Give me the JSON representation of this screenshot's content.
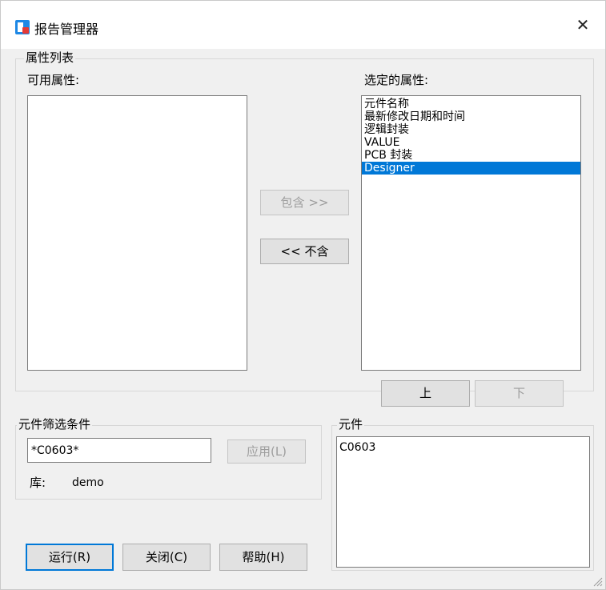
{
  "window": {
    "title": "报告管理器",
    "close_glyph": "✕"
  },
  "property_group": {
    "title": "属性列表",
    "available_label": "可用属性:",
    "selected_label": "选定的属性:",
    "available_items": [],
    "selected_items": [
      "元件名称",
      "最新修改日期和时间",
      "逻辑封装",
      "VALUE",
      "PCB 封装",
      "Designer"
    ],
    "selected_index": 5,
    "include_button": "包含 >>",
    "exclude_button": "<< 不含",
    "up_button": "上",
    "down_button": "下"
  },
  "filter_group": {
    "title": "元件筛选条件",
    "filter_value": "*C0603*",
    "apply_button": "应用(L)",
    "library_label": "库:",
    "library_value": "demo"
  },
  "parts_group": {
    "title": "元件",
    "items": [
      "C0603"
    ]
  },
  "footer": {
    "run_button": "运行(R)",
    "close_button": "关闭(C)",
    "help_button": "帮助(H)"
  },
  "colors": {
    "selection": "#0078d7",
    "dialog_bg": "#f0f0f0"
  },
  "icons": {
    "app": "report-manager-app-icon",
    "close": "close-icon"
  }
}
